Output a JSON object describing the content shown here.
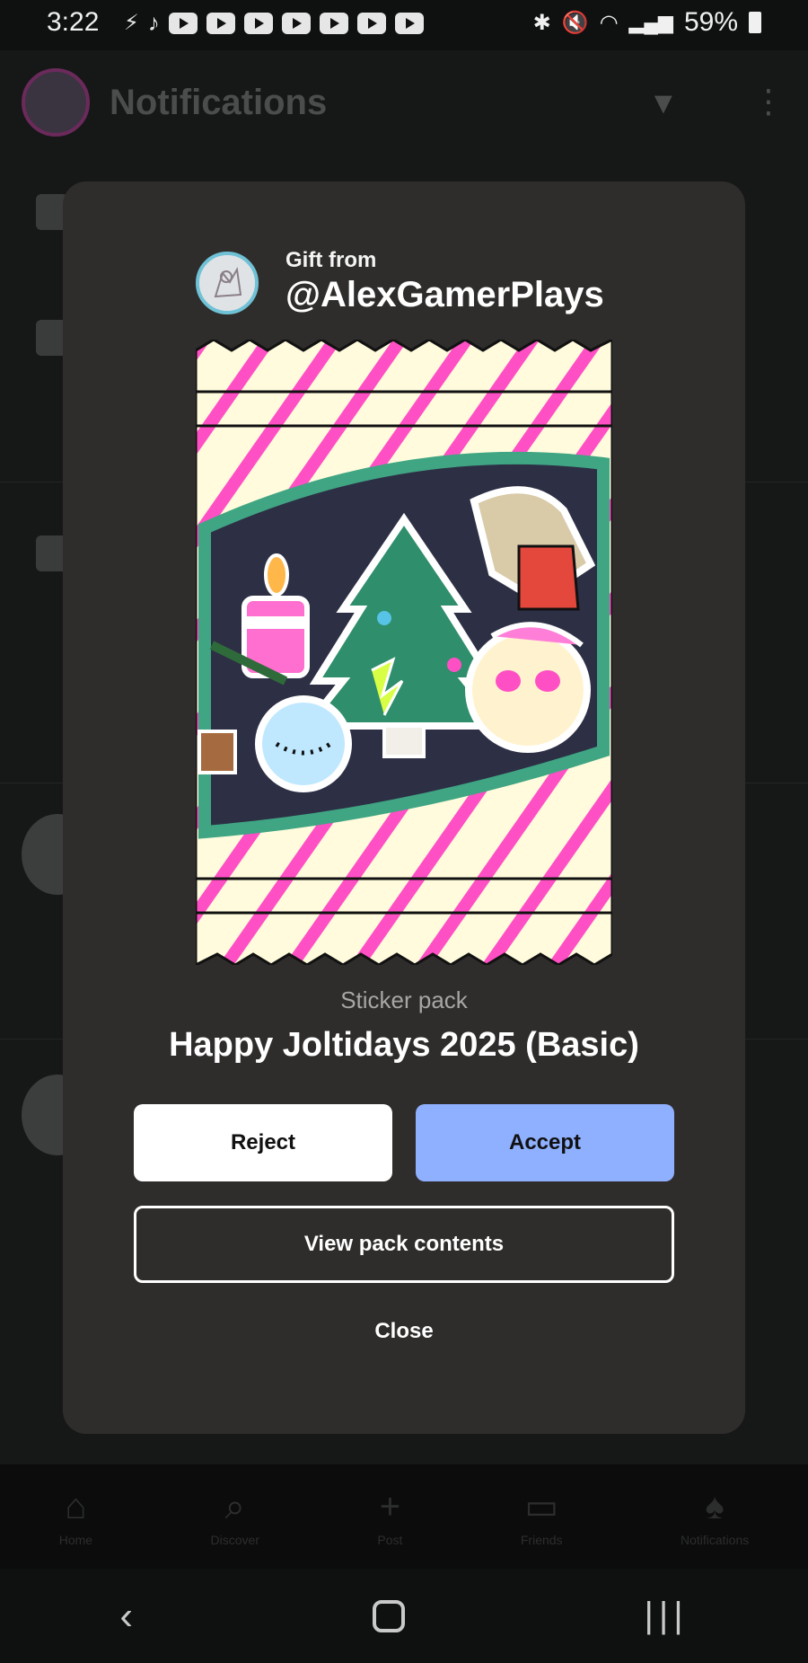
{
  "status_bar": {
    "time": "3:22",
    "battery": "59%",
    "left_icons": [
      "bolt-icon",
      "tiktok-icon",
      "youtube-icon",
      "youtube-icon",
      "youtube-icon",
      "youtube-icon",
      "youtube-icon",
      "youtube-icon",
      "youtube-icon"
    ],
    "right_icons": [
      "bluetooth-icon",
      "mute-icon",
      "wifi-icon",
      "signal-icon",
      "battery-icon"
    ]
  },
  "background": {
    "title": "Notifications",
    "bottom_nav": [
      {
        "label": "Home",
        "icon": "home-icon"
      },
      {
        "label": "Discover",
        "icon": "search-icon"
      },
      {
        "label": "Post",
        "icon": "plus-icon"
      },
      {
        "label": "Friends",
        "icon": "chat-icon"
      },
      {
        "label": "Notifications",
        "icon": "bell-icon"
      }
    ]
  },
  "gift": {
    "from_label": "Gift from",
    "username": "@AlexGamerPlays",
    "pack_type": "Sticker pack",
    "pack_name": "Happy Joltidays 2025 (Basic)"
  },
  "actions": {
    "reject": "Reject",
    "accept": "Accept",
    "view_contents": "View pack contents",
    "close": "Close"
  },
  "colors": {
    "modal_bg": "#2f2d2b",
    "accept_bg": "#8fb0ff",
    "pack_stripe": "#ff4fc4",
    "pack_base": "#fffbdc"
  }
}
